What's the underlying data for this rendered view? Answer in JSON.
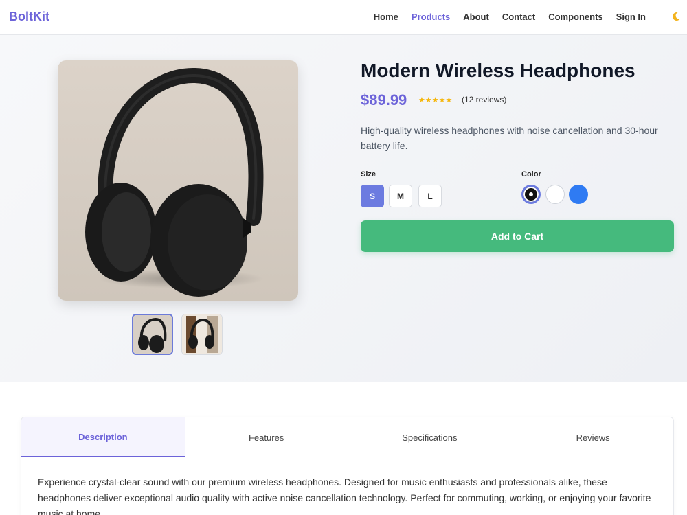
{
  "nav": {
    "brand": "BoltKit",
    "links": [
      "Home",
      "Products",
      "About",
      "Contact",
      "Components",
      "Sign In"
    ],
    "active": "Products",
    "theme_icon": "moon-icon"
  },
  "product": {
    "title": "Modern Wireless Headphones",
    "price": "$89.99",
    "rating_stars": "★★★★★",
    "rating": 5,
    "reviews": "(12 reviews)",
    "description": "High-quality wireless headphones with noise cancellation and 30-hour battery life.",
    "size_label": "Size",
    "sizes": [
      "S",
      "M",
      "L"
    ],
    "selected_size": "S",
    "color_label": "Color",
    "colors": [
      "#111111",
      "#ffffff",
      "#2f7bf3"
    ],
    "selected_color": "#111111",
    "add_to_cart": "Add to Cart"
  },
  "tabs": {
    "items": [
      "Description",
      "Features",
      "Specifications",
      "Reviews"
    ],
    "active": "Description",
    "body": "Experience crystal-clear sound with our premium wireless headphones. Designed for music enthusiasts and professionals alike, these headphones deliver exceptional audio quality with active noise cancellation technology. Perfect for commuting, working, or enjoying your favorite music at home."
  },
  "colors": {
    "accent": "#6c63d9",
    "cart": "#45ba7d",
    "star": "#f5b60a"
  }
}
